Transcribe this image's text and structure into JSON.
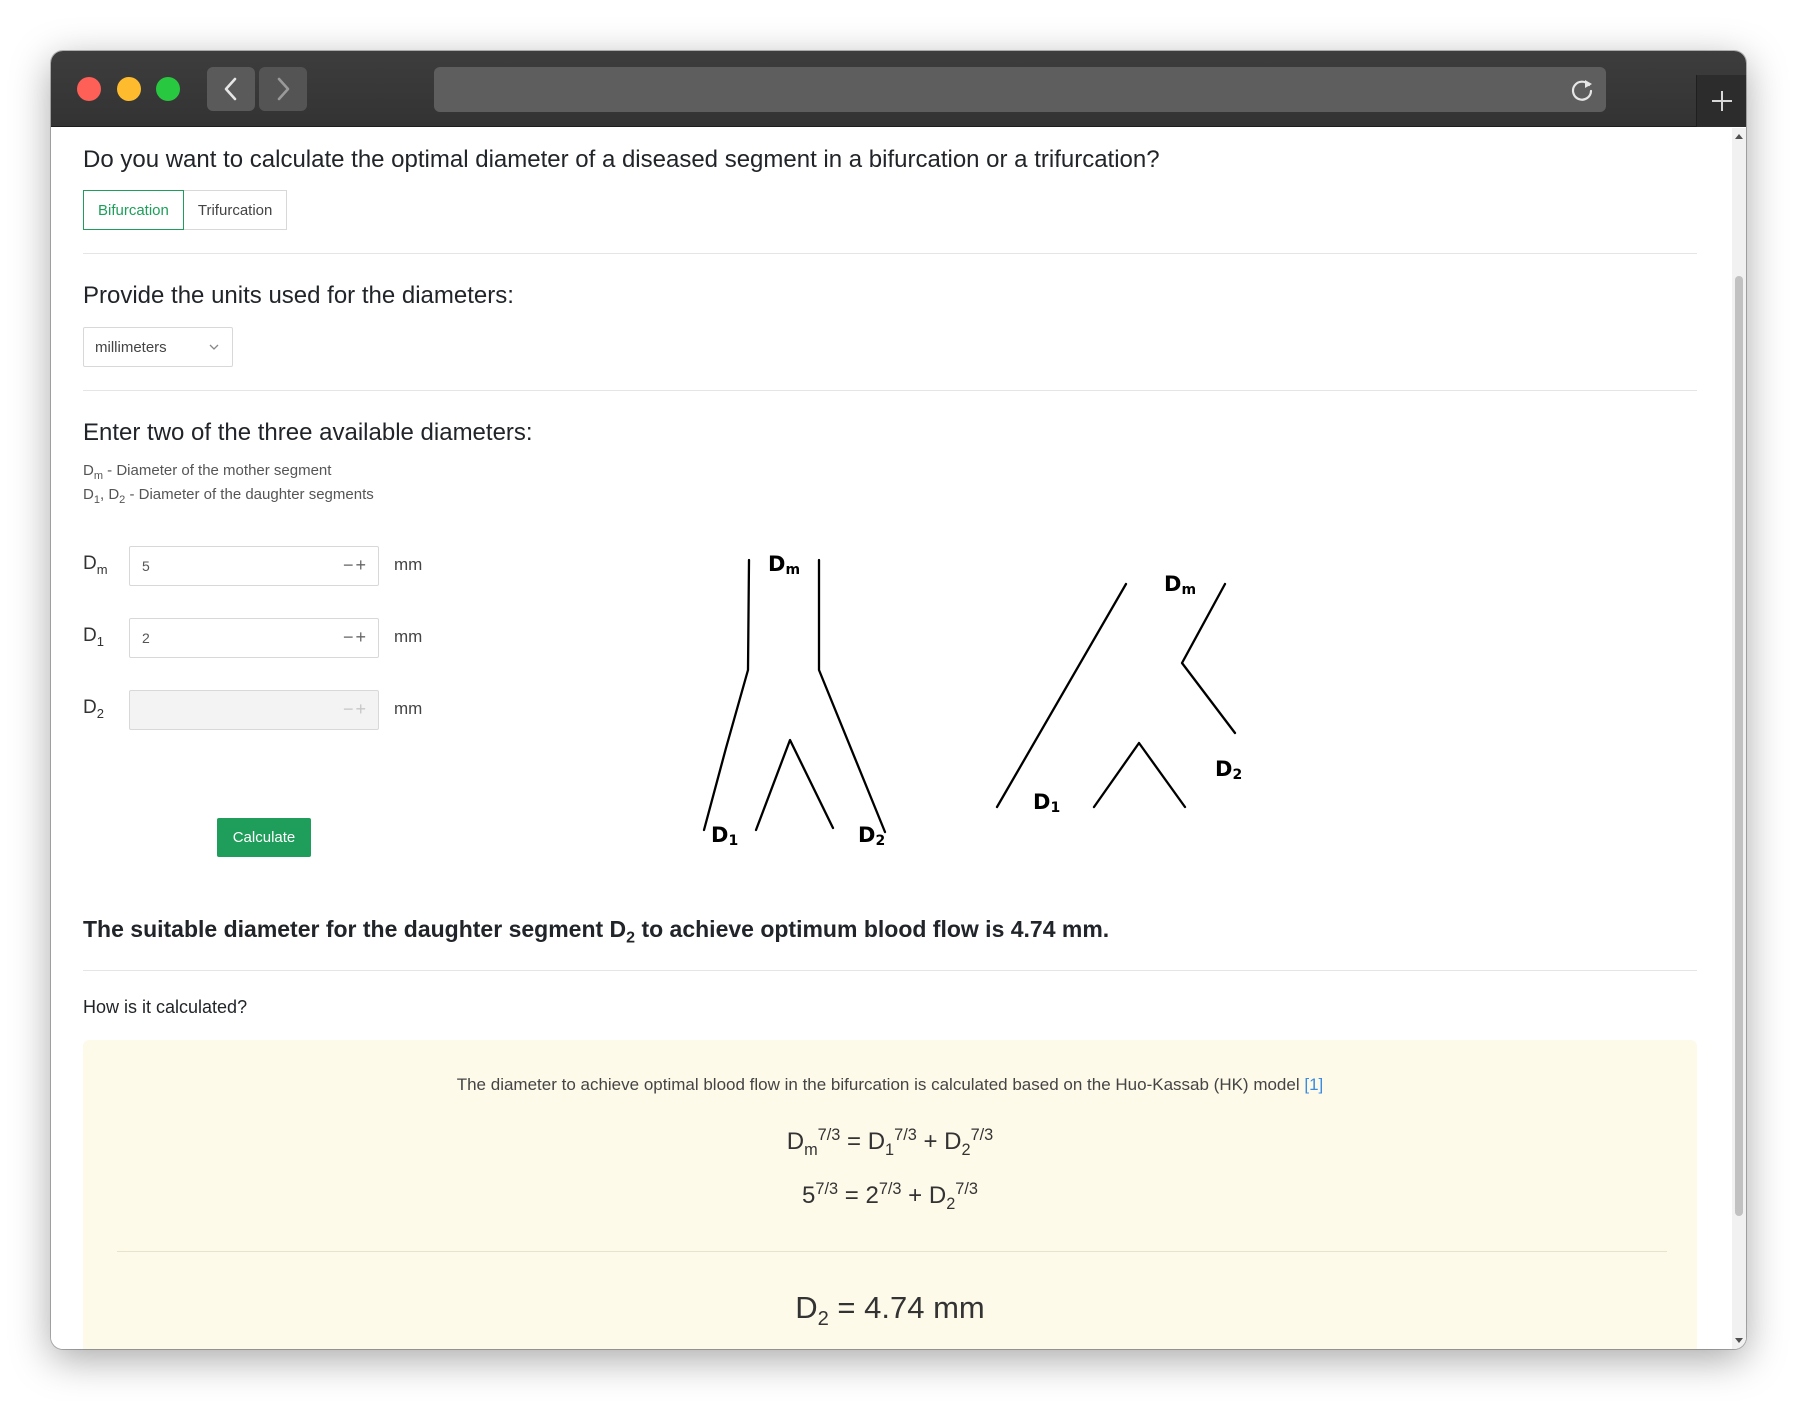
{
  "q_type": "Do you want to calculate the optimal diameter of a diseased segment in a bifurcation or a trifurcation?",
  "type_options": [
    "Bifurcation",
    "Trifurcation"
  ],
  "selected_type": "Bifurcation",
  "q_units": "Provide the units used for the diameters:",
  "units_value": "millimeters",
  "q_diameters": "Enter two of the three available diameters:",
  "hint_dm": " - Diameter of the mother segment",
  "hint_d": " - Diameter of the daughter segments",
  "inputs": [
    {
      "label_main": "D",
      "label_sub": "m",
      "value": "5",
      "unit": "mm"
    },
    {
      "label_main": "D",
      "label_sub": "1",
      "value": "2",
      "unit": "mm"
    },
    {
      "label_main": "D",
      "label_sub": "2",
      "value": "",
      "unit": "mm"
    }
  ],
  "calculate_label": "Calculate",
  "diagram_labels": {
    "dm": "D",
    "dm_sub": "m",
    "d1": "D",
    "d1_sub": "1",
    "d2": "D",
    "d2_sub": "2"
  },
  "result_pre": "The suitable diameter for the daughter segment D",
  "result_sub": "2",
  "result_post": " to achieve optimum blood flow is 4.74 mm.",
  "how_label": "How is it calculated?",
  "explain_text": "The diameter to achieve optimal blood flow in the bifurcation is calculated based on the Huo-Kassab (HK) model ",
  "explain_ref": "[1]",
  "exponent": "7/3",
  "eq2_values": {
    "dm": "5",
    "d1": "2"
  },
  "final_value": "4.74 mm",
  "colors": {
    "accent": "#1e9e5a",
    "explain_bg": "#fefaea",
    "link": "#3b8be0"
  }
}
